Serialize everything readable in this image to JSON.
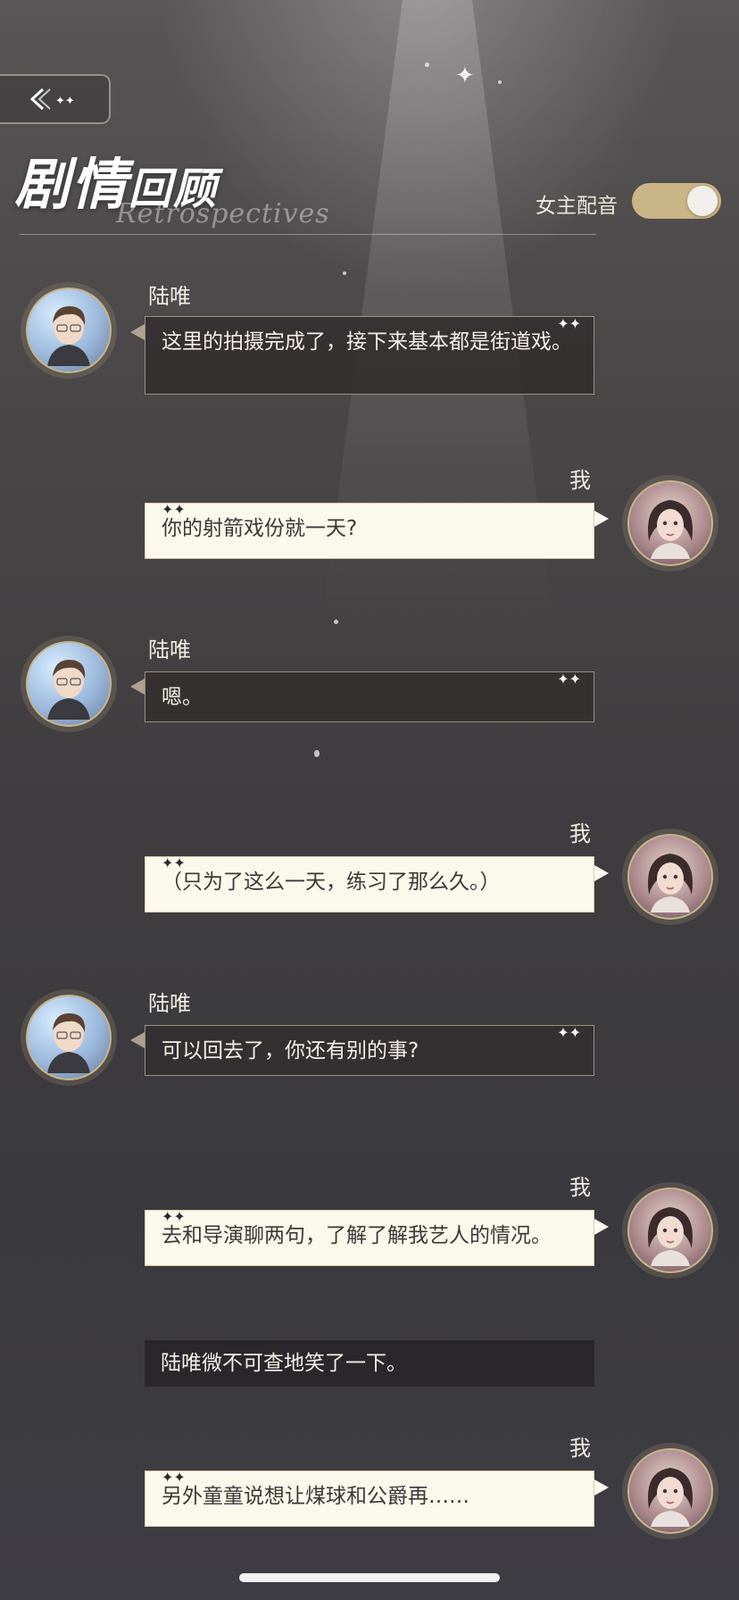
{
  "header": {
    "title_big": "剧情",
    "title_small": "回顾",
    "subtitle": "Retrospectives",
    "voice_label": "女主配音",
    "voice_on": true
  },
  "messages": [
    {
      "speaker": "陆唯",
      "side": "left",
      "text": "这里的拍摄完成了，接下来基本都是街道戏。"
    },
    {
      "speaker": "我",
      "side": "right",
      "text": "你的射箭戏份就一天?"
    },
    {
      "speaker": "陆唯",
      "side": "left",
      "text": "嗯。"
    },
    {
      "speaker": "我",
      "side": "right",
      "text": "（只为了这么一天，练习了那么久。）"
    },
    {
      "speaker": "陆唯",
      "side": "left",
      "text": "可以回去了，你还有别的事?"
    },
    {
      "speaker": "我",
      "side": "right",
      "text": "去和导演聊两句，了解了解我艺人的情况。"
    },
    {
      "speaker": "",
      "side": "narration",
      "text": "陆唯微不可查地笑了一下。"
    },
    {
      "speaker": "我",
      "side": "right",
      "text": "另外童童说想让煤球和公爵再……"
    }
  ],
  "icons": {
    "back": "back-arrow-icon",
    "sparkle": "sparkle-icon"
  }
}
